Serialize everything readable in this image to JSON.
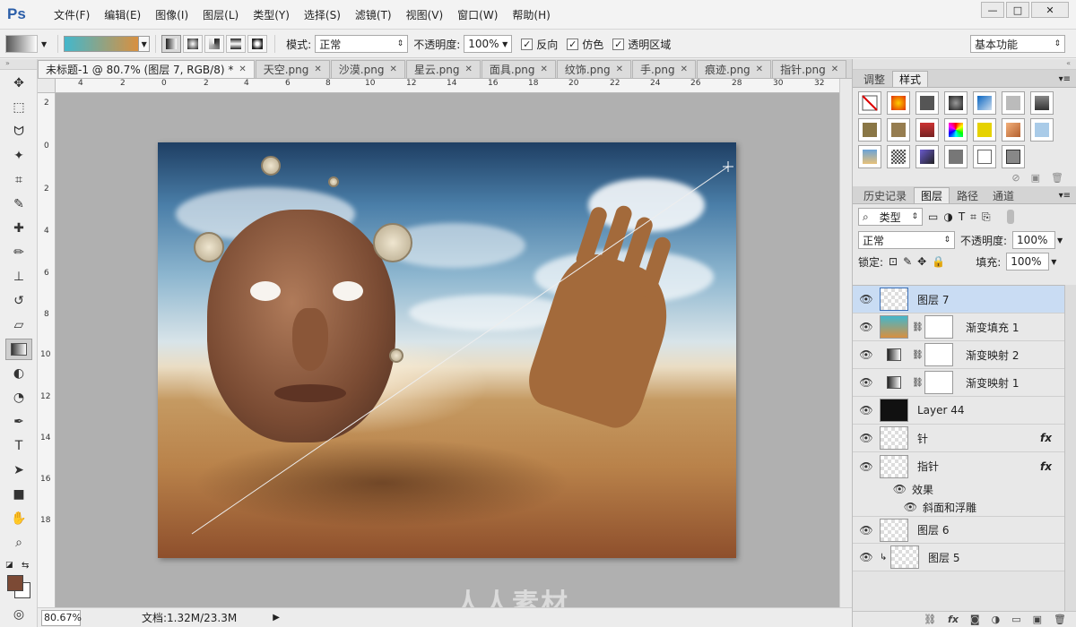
{
  "app": {
    "logo": "Ps"
  },
  "menu": [
    "文件(F)",
    "编辑(E)",
    "图像(I)",
    "图层(L)",
    "类型(Y)",
    "选择(S)",
    "滤镜(T)",
    "视图(V)",
    "窗口(W)",
    "帮助(H)"
  ],
  "window_controls": {
    "minimize": "—",
    "maximize": "□",
    "close": "✕"
  },
  "options": {
    "mode_label": "模式:",
    "mode_value": "正常",
    "opacity_label": "不透明度:",
    "opacity_value": "100%",
    "reverse_label": "反向",
    "dither_label": "仿色",
    "transparency_label": "透明区域",
    "workspace": "基本功能",
    "colors": {
      "gradient_start": "#43b7cc",
      "gradient_end": "#d89040"
    }
  },
  "tabs": [
    {
      "label": "未标题-1 @ 80.7% (图层 7, RGB/8) *",
      "active": true
    },
    {
      "label": "天空.png"
    },
    {
      "label": "沙漠.png"
    },
    {
      "label": "星云.png"
    },
    {
      "label": "面具.png"
    },
    {
      "label": "纹饰.png"
    },
    {
      "label": "手.png"
    },
    {
      "label": "痕迹.png"
    },
    {
      "label": "指针.png"
    }
  ],
  "ruler_h": [
    "4",
    "2",
    "0",
    "2",
    "4",
    "6",
    "8",
    "10",
    "12",
    "14",
    "16",
    "18",
    "20",
    "22",
    "24",
    "26",
    "28",
    "30",
    "32"
  ],
  "ruler_v": [
    "2",
    "0",
    "2",
    "4",
    "6",
    "8",
    "10",
    "12",
    "14",
    "16",
    "18"
  ],
  "status": {
    "zoom": "80.67%",
    "doc": "文档:1.32M/23.3M"
  },
  "watermark": "人人素材",
  "colors": {
    "foreground": "#7c4a35",
    "background": "#ffffff"
  },
  "styles_panel": {
    "tabs": [
      "调整",
      "样式"
    ],
    "active_tab": "样式"
  },
  "layers_panel": {
    "tabs": [
      "历史记录",
      "图层",
      "路径",
      "通道"
    ],
    "active_tab": "图层",
    "filter_label": "类型",
    "blend_mode": "正常",
    "opacity_label": "不透明度:",
    "opacity_value": "100%",
    "lock_label": "锁定:",
    "fill_label": "填充:",
    "fill_value": "100%",
    "layers": [
      {
        "name": "图层 7",
        "selected": true,
        "thumb": "transparent"
      },
      {
        "name": "渐变填充 1",
        "thumb": "gradient",
        "mask": true
      },
      {
        "name": "渐变映射 2",
        "thumb": "adjustment",
        "mask": true
      },
      {
        "name": "渐变映射 1",
        "thumb": "adjustment",
        "mask": true
      },
      {
        "name": "Layer 44",
        "thumb": "black"
      },
      {
        "name": "针",
        "thumb": "transparent",
        "fx": "fx"
      },
      {
        "name": "指针",
        "thumb": "transparent",
        "fx": "fx"
      },
      {
        "name": "效果",
        "sub": true
      },
      {
        "name": "斜面和浮雕",
        "sub": true,
        "deep": true
      },
      {
        "name": "图层 6",
        "thumb": "transparent"
      },
      {
        "name": "图层 5",
        "thumb": "transparent"
      }
    ]
  }
}
